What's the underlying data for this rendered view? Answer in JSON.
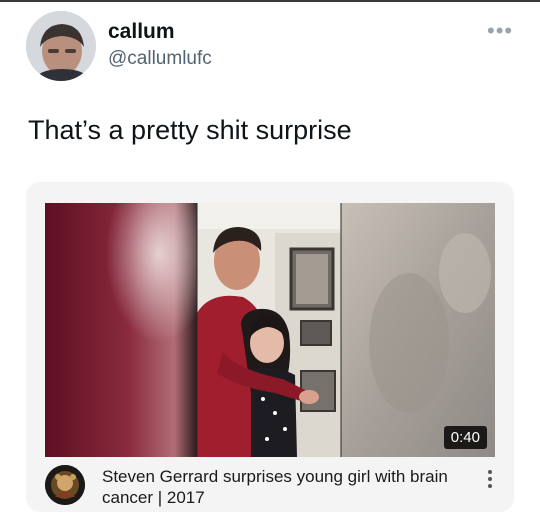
{
  "tweet": {
    "display_name": "callum",
    "handle": "@callumlufc",
    "text": "That’s a pretty shit surprise",
    "more_icon": "more-horizontal-icon"
  },
  "video_card": {
    "title": "Steven Gerrard surprises young girl with brain cancer | 2017",
    "duration": "0:40",
    "menu_icon": "more-vertical-icon"
  }
}
